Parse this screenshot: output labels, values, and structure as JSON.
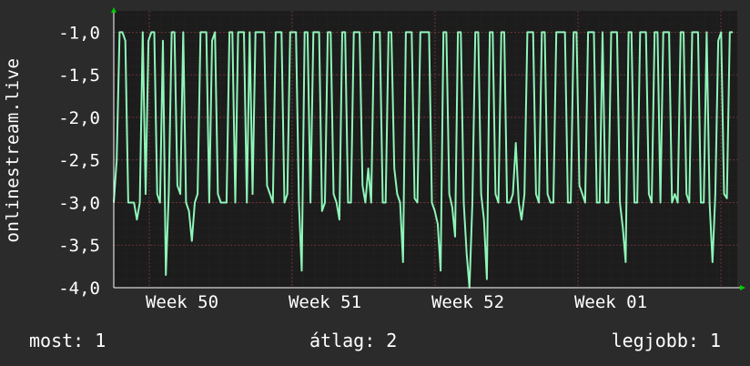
{
  "colors": {
    "background": "#2b2b2b",
    "plot_background": "#1c1c1c",
    "line": "#8ef5b8",
    "grid": "#5a3030",
    "text": "#ffffff",
    "arrow": "#00cc00"
  },
  "chart_data": {
    "type": "line",
    "title": "",
    "ylabel": "onlinestream.live",
    "xlabel": "",
    "ylim": [
      -4.0,
      -0.75
    ],
    "yticks": [
      "-1,0",
      "-1,5",
      "-2,0",
      "-2,5",
      "-3,0",
      "-3,5",
      "-4,0"
    ],
    "ytick_values": [
      -1.0,
      -1.5,
      -2.0,
      -2.5,
      -3.0,
      -3.5,
      -4.0
    ],
    "xticks": [
      "Week 50",
      "Week 51",
      "Week 52",
      "Week 01"
    ],
    "grid": true,
    "legend": "none",
    "series": [
      {
        "values": [
          -3.0,
          -2.5,
          -1.0,
          -1.0,
          -1.1,
          -3.0,
          -3.0,
          -3.0,
          -3.2,
          -3.0,
          -1.0,
          -2.9,
          -1.1,
          -1.0,
          -1.0,
          -2.9,
          -3.0,
          -1.1,
          -3.85,
          -2.9,
          -1.0,
          -1.0,
          -2.8,
          -2.9,
          -1.0,
          -3.0,
          -3.1,
          -3.45,
          -3.0,
          -2.9,
          -1.0,
          -1.0,
          -1.0,
          -3.0,
          -1.1,
          -1.0,
          -2.9,
          -3.0,
          -3.0,
          -3.0,
          -1.0,
          -1.0,
          -3.0,
          -1.0,
          -1.0,
          -1.0,
          -3.0,
          -1.0,
          -2.9,
          -1.0,
          -1.0,
          -1.0,
          -1.0,
          -2.8,
          -2.9,
          -3.0,
          -1.0,
          -1.0,
          -1.0,
          -3.0,
          -2.9,
          -1.0,
          -1.0,
          -1.0,
          -3.0,
          -3.8,
          -1.0,
          -1.0,
          -3.0,
          -1.0,
          -1.0,
          -1.0,
          -3.1,
          -3.0,
          -1.0,
          -1.0,
          -2.9,
          -3.0,
          -3.2,
          -1.0,
          -1.0,
          -3.0,
          -3.0,
          -1.0,
          -1.0,
          -1.0,
          -2.8,
          -3.0,
          -2.6,
          -3.0,
          -1.0,
          -1.0,
          -1.0,
          -3.0,
          -3.0,
          -1.0,
          -1.0,
          -2.6,
          -2.9,
          -3.0,
          -3.7,
          -1.0,
          -1.0,
          -1.0,
          -2.95,
          -3.0,
          -1.0,
          -1.0,
          -1.0,
          -1.0,
          -3.0,
          -3.1,
          -3.25,
          -3.8,
          -1.0,
          -1.0,
          -2.9,
          -3.05,
          -3.4,
          -1.0,
          -1.0,
          -3.0,
          -3.6,
          -4.0,
          -3.0,
          -1.0,
          -1.0,
          -2.9,
          -3.2,
          -3.9,
          -1.0,
          -1.0,
          -2.9,
          -3.0,
          -1.0,
          -1.0,
          -3.0,
          -3.0,
          -2.9,
          -2.3,
          -3.0,
          -3.2,
          -2.9,
          -1.0,
          -1.0,
          -1.0,
          -2.9,
          -3.0,
          -1.0,
          -1.0,
          -2.9,
          -3.0,
          -3.0,
          -1.0,
          -1.0,
          -1.0,
          -1.0,
          -3.0,
          -3.0,
          -1.0,
          -1.0,
          -2.8,
          -2.9,
          -3.0,
          -1.0,
          -1.0,
          -1.0,
          -3.0,
          -3.0,
          -1.0,
          -3.0,
          -3.0,
          -1.0,
          -1.0,
          -1.0,
          -3.0,
          -3.3,
          -3.7,
          -1.0,
          -1.0,
          -3.0,
          -3.0,
          -1.0,
          -1.0,
          -1.0,
          -2.9,
          -3.0,
          -1.0,
          -1.0,
          -3.0,
          -1.0,
          -1.0,
          -1.0,
          -3.0,
          -2.9,
          -3.0,
          -1.0,
          -1.0,
          -2.9,
          -3.0,
          -1.0,
          -1.0,
          -1.0,
          -3.0,
          -3.0,
          -1.0,
          -3.0,
          -3.7,
          -2.9,
          -1.1,
          -1.0,
          -2.9,
          -2.95,
          -1.0,
          -1.0
        ]
      }
    ]
  },
  "stats": {
    "now": "most: 1",
    "average": "átlag: 2",
    "best": "legjobb: 1"
  }
}
